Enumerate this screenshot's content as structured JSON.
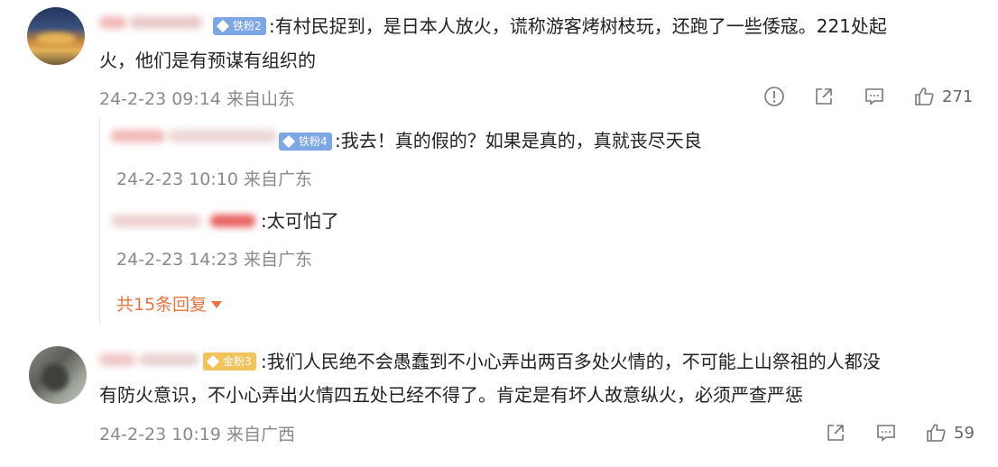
{
  "comments": [
    {
      "badge": "铁粉2",
      "text_line1": ":有村民捉到，是日本人放火，谎称游客烤树枝玩，还跑了一些倭寇。221处起",
      "text_line2": "火，他们是有预谋有组织的",
      "meta": "24-2-23 09:14 来自山东",
      "likes": "271",
      "replies": [
        {
          "badge": "铁粉4",
          "text": ":我去！真的假的？如果是真的，真就丧尽天良",
          "meta": "24-2-23 10:10 来自广东"
        },
        {
          "badge": "",
          "text": ":太可怕了",
          "meta": "24-2-23 14:23 来自广东"
        }
      ],
      "more_replies": "共15条回复"
    },
    {
      "badge": "金粉3",
      "text_line1": ":我们人民绝不会愚蠢到不小心弄出两百多处火情的，不可能上山祭祖的人都没",
      "text_line2": "有防火意识，不小心弄出火情四五处已经不得了。肯定是有坏人故意纵火，必须严查严惩",
      "meta": "24-2-23 10:19 来自广西",
      "likes": "59"
    }
  ],
  "icons": {
    "report": "report-icon",
    "share": "share-icon",
    "comment": "comment-icon",
    "like": "like-icon"
  },
  "colors": {
    "badge_iron": "#7da6e6",
    "badge_gold": "#f1c35a",
    "more_link": "#eb7340",
    "meta_text": "#8a8a8a"
  }
}
